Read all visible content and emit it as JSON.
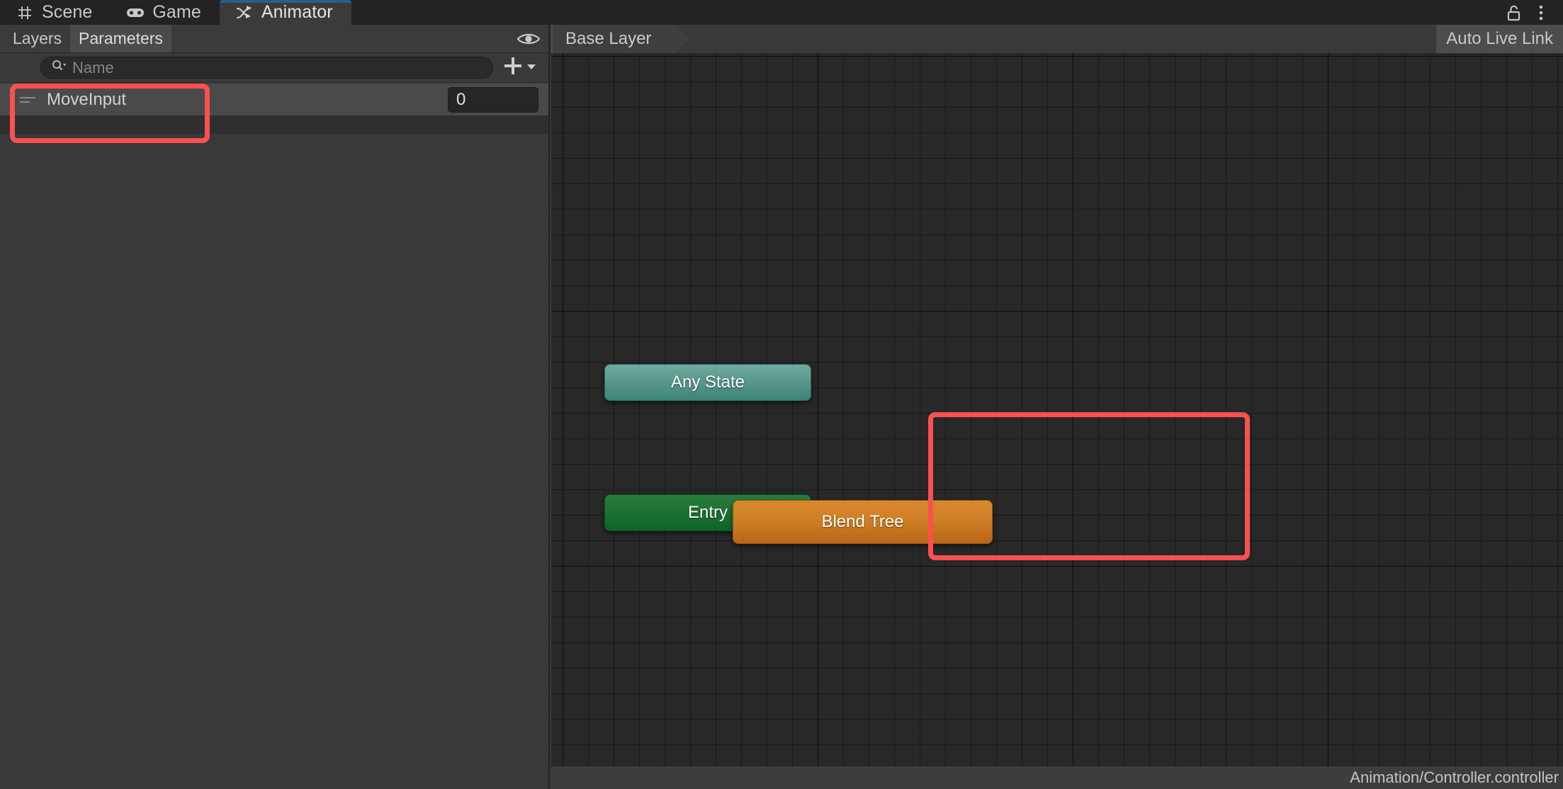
{
  "window": {
    "tabs": [
      {
        "label": "Scene",
        "icon": "grid-icon",
        "active": false
      },
      {
        "label": "Game",
        "icon": "gamepad-icon",
        "active": false
      },
      {
        "label": "Animator",
        "icon": "animator-branch-icon",
        "active": true
      }
    ],
    "lock_icon": "unlock-icon",
    "menu_icon": "kebab-menu-icon"
  },
  "left_panel": {
    "subtabs": [
      {
        "label": "Layers",
        "active": false
      },
      {
        "label": "Parameters",
        "active": true
      }
    ],
    "visibility_icon": "eye-icon",
    "search": {
      "placeholder": "Name",
      "value": "",
      "icon": "search-icon",
      "dropdown_icon": "chevron-down-icon"
    },
    "add_button": {
      "label": "+",
      "icon": "plus-icon",
      "dropdown_icon": "chevron-down-icon"
    },
    "parameters": [
      {
        "name": "MoveInput",
        "value": "0",
        "handle_icon": "drag-handle-icon"
      }
    ]
  },
  "graph": {
    "breadcrumb": "Base Layer",
    "live_link_label": "Auto Live Link",
    "nodes": [
      {
        "name": "Any State",
        "type": "any-state",
        "color": "#4f9387"
      },
      {
        "name": "Entry",
        "type": "entry",
        "color": "#16702c"
      },
      {
        "name": "Blend Tree",
        "type": "blend-tree",
        "color": "#cc7a22"
      }
    ],
    "transition": {
      "from": "Entry",
      "to": "Blend Tree",
      "color": "#cc8b12",
      "arrow_icon": "transition-arrow-icon"
    },
    "status_path": "Animation/Controller.controller"
  },
  "annotations": {
    "accent_color": "#fc5050",
    "highlights": [
      {
        "target": "MoveInput parameter row"
      },
      {
        "target": "Blend Tree node"
      }
    ]
  }
}
